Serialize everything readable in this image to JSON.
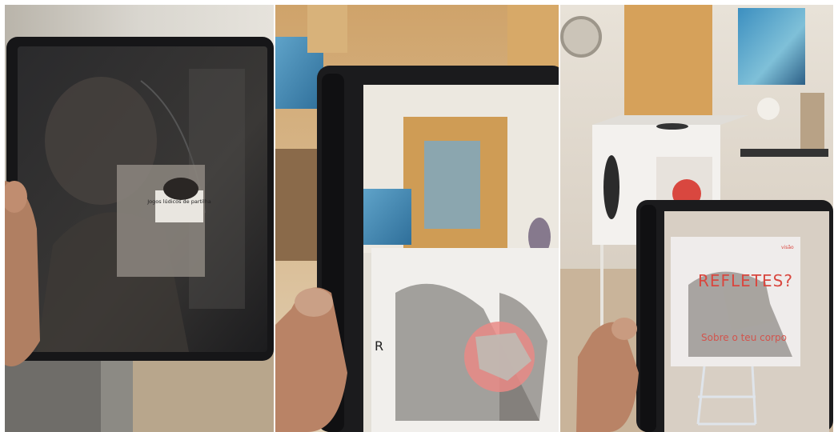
{
  "panels": [
    {
      "id": "panel-1",
      "card_text": "Jogos lúdicos de partilha"
    },
    {
      "id": "panel-2",
      "edge_letter": "R"
    },
    {
      "id": "panel-3",
      "headline": "REFLETES?",
      "subline": "Sobre o teu corpo",
      "logo_text": "visão"
    }
  ],
  "colors": {
    "tablet_frame": "#1b1b1d",
    "ar_pink": "#e98a86",
    "headline_red": "#d9473f",
    "wall": "#e9e4dc",
    "wood": "#c99a55"
  }
}
